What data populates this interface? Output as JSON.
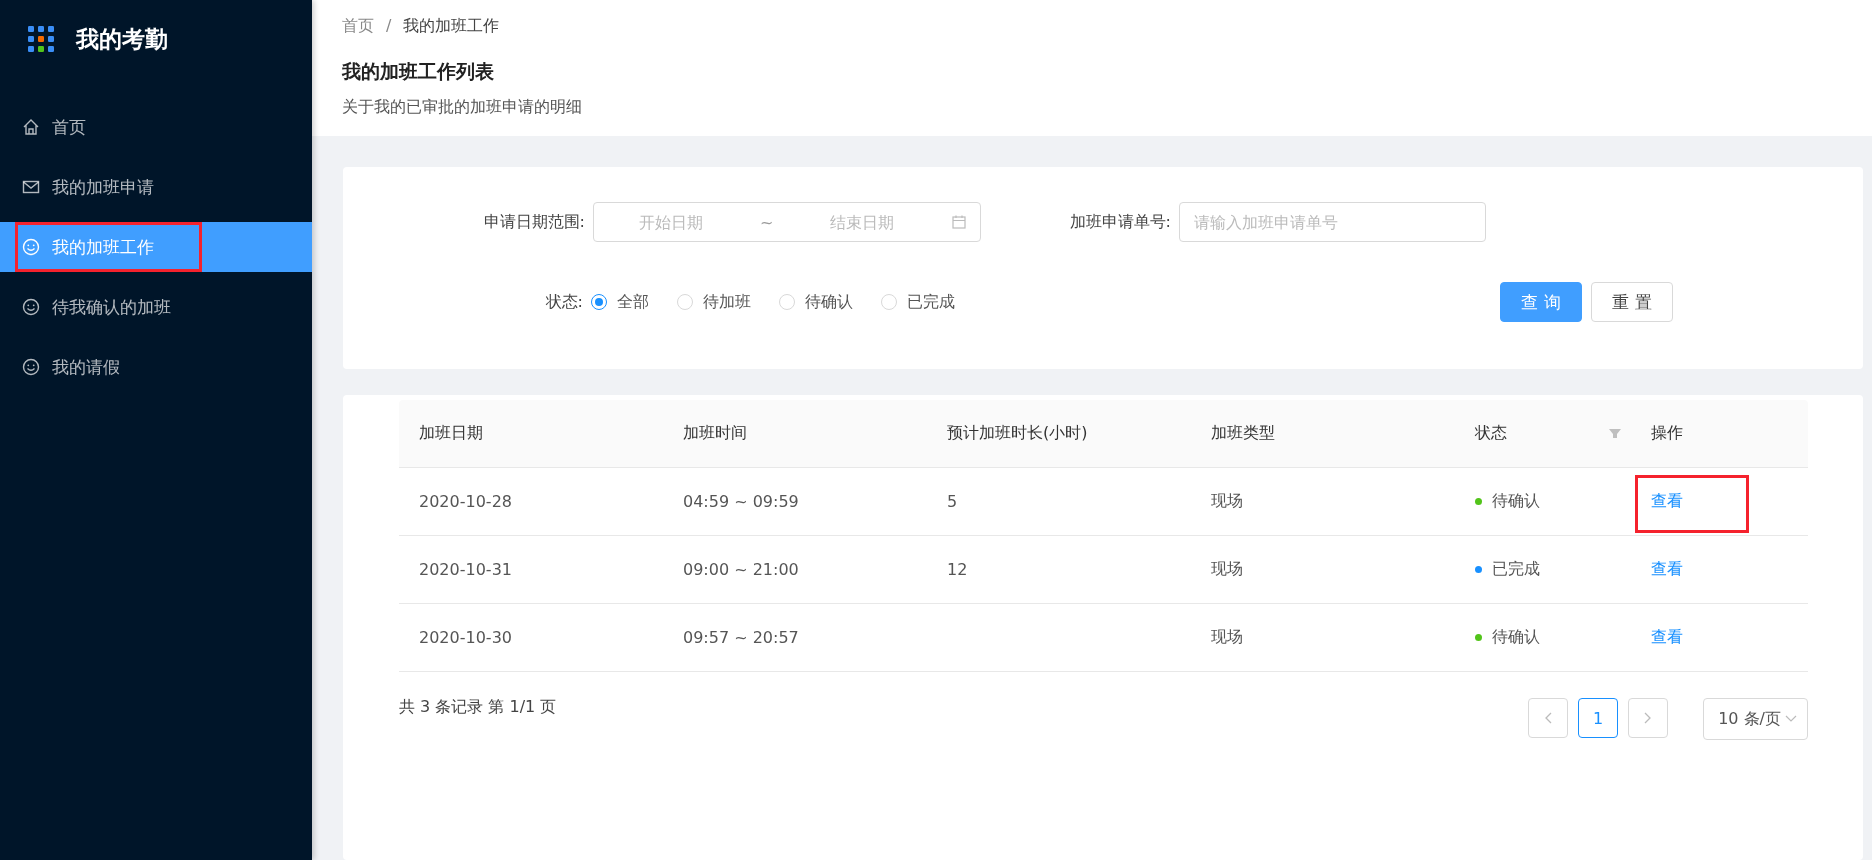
{
  "sidebar": {
    "title": "我的考勤",
    "items": [
      {
        "label": "首页",
        "kind": "home",
        "selected": false,
        "highlighted": false
      },
      {
        "label": "我的加班申请",
        "kind": "mail",
        "selected": false,
        "highlighted": false
      },
      {
        "label": "我的加班工作",
        "kind": "smile",
        "selected": true,
        "highlighted": true
      },
      {
        "label": "待我确认的加班",
        "kind": "smile",
        "selected": false,
        "highlighted": false
      },
      {
        "label": "我的请假",
        "kind": "smile",
        "selected": false,
        "highlighted": false
      }
    ]
  },
  "breadcrumb": {
    "items": [
      "首页",
      "我的加班工作"
    ],
    "separator": "/"
  },
  "page_title": "我的加班工作列表",
  "page_subtitle": "关于我的已审批的加班申请的明细",
  "filters": {
    "date_label": "申请日期范围:",
    "start_placeholder": "开始日期",
    "separator": "~",
    "end_placeholder": "结束日期",
    "number_label": "加班申请单号:",
    "number_placeholder": "请输入加班申请单号",
    "status_label": "状态:",
    "status_options": [
      {
        "label": "全部",
        "selected": true
      },
      {
        "label": "待加班",
        "selected": false
      },
      {
        "label": "待确认",
        "selected": false
      },
      {
        "label": "已完成",
        "selected": false
      }
    ],
    "buttons": [
      {
        "label": "查 询",
        "kind": "primary"
      },
      {
        "label": "重 置",
        "kind": "default"
      }
    ]
  },
  "table": {
    "columns": [
      "加班日期",
      "加班时间",
      "预计加班时长(小时)",
      "加班类型",
      "状态",
      "操作"
    ],
    "rows": [
      {
        "date": "2020-10-28",
        "time": "04:59 ~ 09:59",
        "hours": "5",
        "type": "现场",
        "status": "待确认",
        "color": "#52c41a",
        "action": "查看",
        "highlighted": true
      },
      {
        "date": "2020-10-31",
        "time": "09:00 ~ 21:00",
        "hours": "12",
        "type": "现场",
        "status": "已完成",
        "color": "#1890ff",
        "action": "查看",
        "highlighted": false
      },
      {
        "date": "2020-10-30",
        "time": "09:57 ~ 20:57",
        "type": "现场",
        "status": "待确认",
        "color": "#52c41a",
        "action": "查看",
        "highlighted": false
      }
    ]
  },
  "pagination": {
    "summary": "共 3 条记录 第 1/1 页",
    "pages": [
      {
        "label": "1",
        "selected": true
      }
    ],
    "page_size": "10 条/页"
  }
}
